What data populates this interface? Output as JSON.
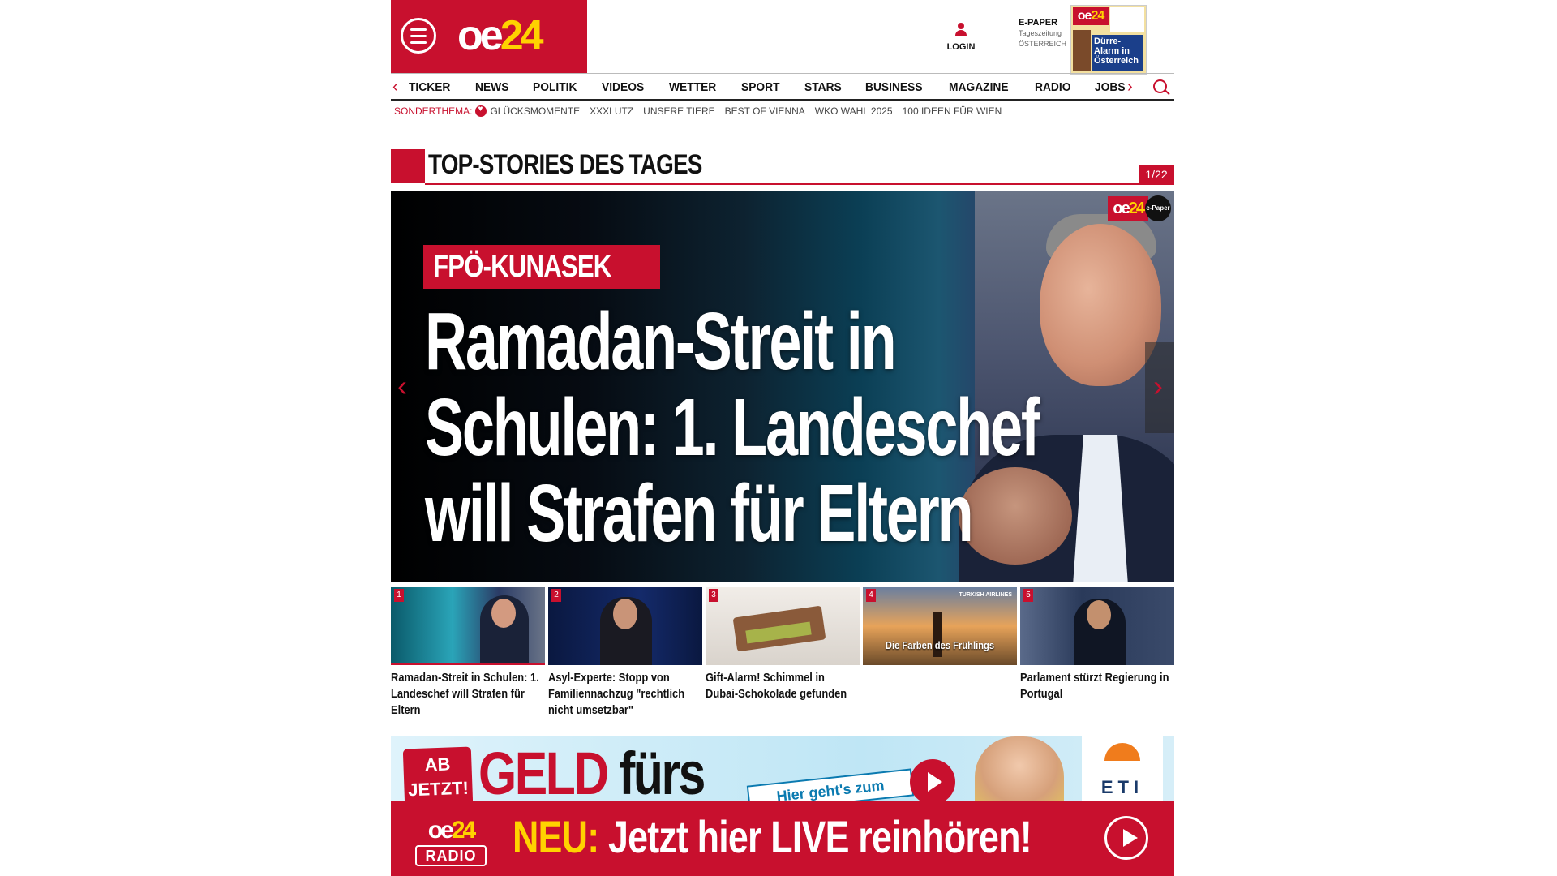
{
  "header": {
    "logo_text": "oe",
    "logo_number": "24",
    "login_label": "LOGIN",
    "epaper": {
      "label": "E-PAPER",
      "sub1": "Tageszeitung",
      "sub2": "ÖSTERREICH",
      "thumb_headline": "Dürre-Alarm in Österreich"
    }
  },
  "nav": {
    "items": [
      "TICKER",
      "NEWS",
      "POLITIK",
      "VIDEOS",
      "WETTER",
      "SPORT",
      "STARS",
      "BUSINESS",
      "MAGAZINE",
      "RADIO",
      "JOBS"
    ]
  },
  "subnav": {
    "label": "SONDERTHEMA:",
    "links": [
      "GLÜCKSMOMENTE",
      "XXXLUTZ",
      "UNSERE TIERE",
      "BEST OF VIENNA",
      "WKO WAHL 2025",
      "100 IDEEN FÜR WIEN"
    ]
  },
  "section": {
    "title": "TOP-STORIES DES TAGES",
    "counter": "1/22"
  },
  "hero": {
    "kicker": "FPÖ-KUNASEK",
    "headline": "Ramadan-Streit in Schulen: 1. Landeschef will Strafen für Eltern",
    "badge_logo": "oe",
    "badge_logo_number": "24",
    "badge_epaper": "e-Paper"
  },
  "thumbs": [
    {
      "num": "1",
      "caption": "Ramadan-Streit in Schulen: 1. Landeschef will Strafen für Eltern"
    },
    {
      "num": "2",
      "caption": "Asyl-Experte: Stopp von Familiennachzug \"rechtlich nicht umsetzbar\""
    },
    {
      "num": "3",
      "caption": "Gift-Alarm! Schimmel in Dubai-Schokolade gefunden"
    },
    {
      "num": "4",
      "caption": "",
      "image_text": "Die Farben des Frühlings",
      "image_tag": "TURKISH AIRLINES"
    },
    {
      "num": "5",
      "caption": "Parlament stürzt Regierung in Portugal"
    }
  ],
  "ad": {
    "badge_line1": "AB",
    "badge_line2": "JETZT!",
    "big_text": "GELD",
    "big_text2": "fürs",
    "cta": "Hier geht's zum",
    "brand": "ETI"
  },
  "radio": {
    "logo_text": "oe",
    "logo_number": "24",
    "logo_label": "RADIO",
    "prefix": "NEU:",
    "text": "Jetzt hier LIVE reinhören!"
  },
  "colors": {
    "brand_red": "#c8102e",
    "brand_yellow": "#ffd200"
  }
}
